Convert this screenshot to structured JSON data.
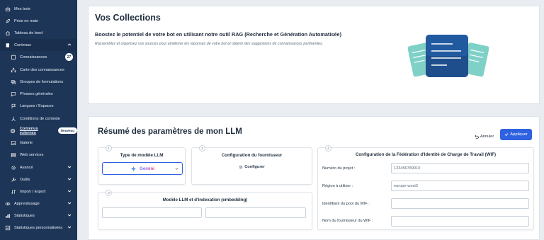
{
  "sidebar": {
    "items": [
      {
        "label": "Mes bots",
        "icon": "robot-icon"
      },
      {
        "label": "Prise en main",
        "icon": "rocket-icon"
      },
      {
        "label": "Tableau de bord",
        "icon": "home-icon"
      },
      {
        "label": "Contenus",
        "icon": "book-icon"
      },
      {
        "label": "Connaissances",
        "icon": "document-icon",
        "count": "27"
      },
      {
        "label": "Carte des connaissances",
        "icon": "sitemap-icon"
      },
      {
        "label": "Groupes de formulations",
        "icon": "group-icon"
      },
      {
        "label": "Phrases générales",
        "icon": "chat-icon"
      },
      {
        "label": "Langues / Espaces",
        "icon": "flag-icon"
      },
      {
        "label": "Conditions de contexte",
        "icon": "branch-icon"
      },
      {
        "label": "Contenus externes",
        "icon": "external-icon",
        "badge": "Nouveau"
      },
      {
        "label": "Galerie",
        "icon": "image-icon"
      },
      {
        "label": "Web services",
        "icon": "server-icon"
      },
      {
        "label": "Avancé",
        "icon": "gear-icon"
      },
      {
        "label": "Outils",
        "icon": "wrench-icon"
      },
      {
        "label": "Import / Export",
        "icon": "import-export-icon"
      },
      {
        "label": "Apprentissage",
        "icon": "eye-icon"
      },
      {
        "label": "Statistiques",
        "icon": "chart-icon"
      },
      {
        "label": "Statistiques personnalisées",
        "icon": "custom-chart-icon"
      }
    ]
  },
  "collections": {
    "title": "Vos Collections",
    "subtitle": "Boostez le potentiel de votre bot en utilisant notre outil RAG (Recherche et Génération Automatisée)",
    "description": "Rassemblez et organisez vos sources pour améliorer les réponses de votre bot et obtenir des suggestions de connaissances pertinentes."
  },
  "llm": {
    "title": "Résumé des paramètres de mon LLM",
    "cancel_label": "Annuler",
    "apply_label": "Appliquer",
    "model_type": {
      "step": "1",
      "title": "Type de modèle LLM",
      "selected": "Gemini"
    },
    "provider": {
      "step": "2",
      "title": "Configuration du fournisseur",
      "configure_label": "Configurer"
    },
    "embedding": {
      "step": "3",
      "title": "Modèle LLM et d'indexation (embedding)"
    },
    "wif": {
      "step": "4",
      "title": "Configuration de la Fédération d'Identité de Charge de Travail (WIF)",
      "fields": [
        {
          "label": "Numéro du projet :",
          "value": "123456789010"
        },
        {
          "label": "Région à utiliser :",
          "value": "europe-west3"
        },
        {
          "label": "Identifiant du pool du WIF :",
          "value": ""
        },
        {
          "label": "Nom du fournisseur du WIF :",
          "value": ""
        }
      ]
    }
  },
  "colors": {
    "sidebar": "#1d3557",
    "accent": "#2f62e0",
    "badge": "#ffffff"
  }
}
